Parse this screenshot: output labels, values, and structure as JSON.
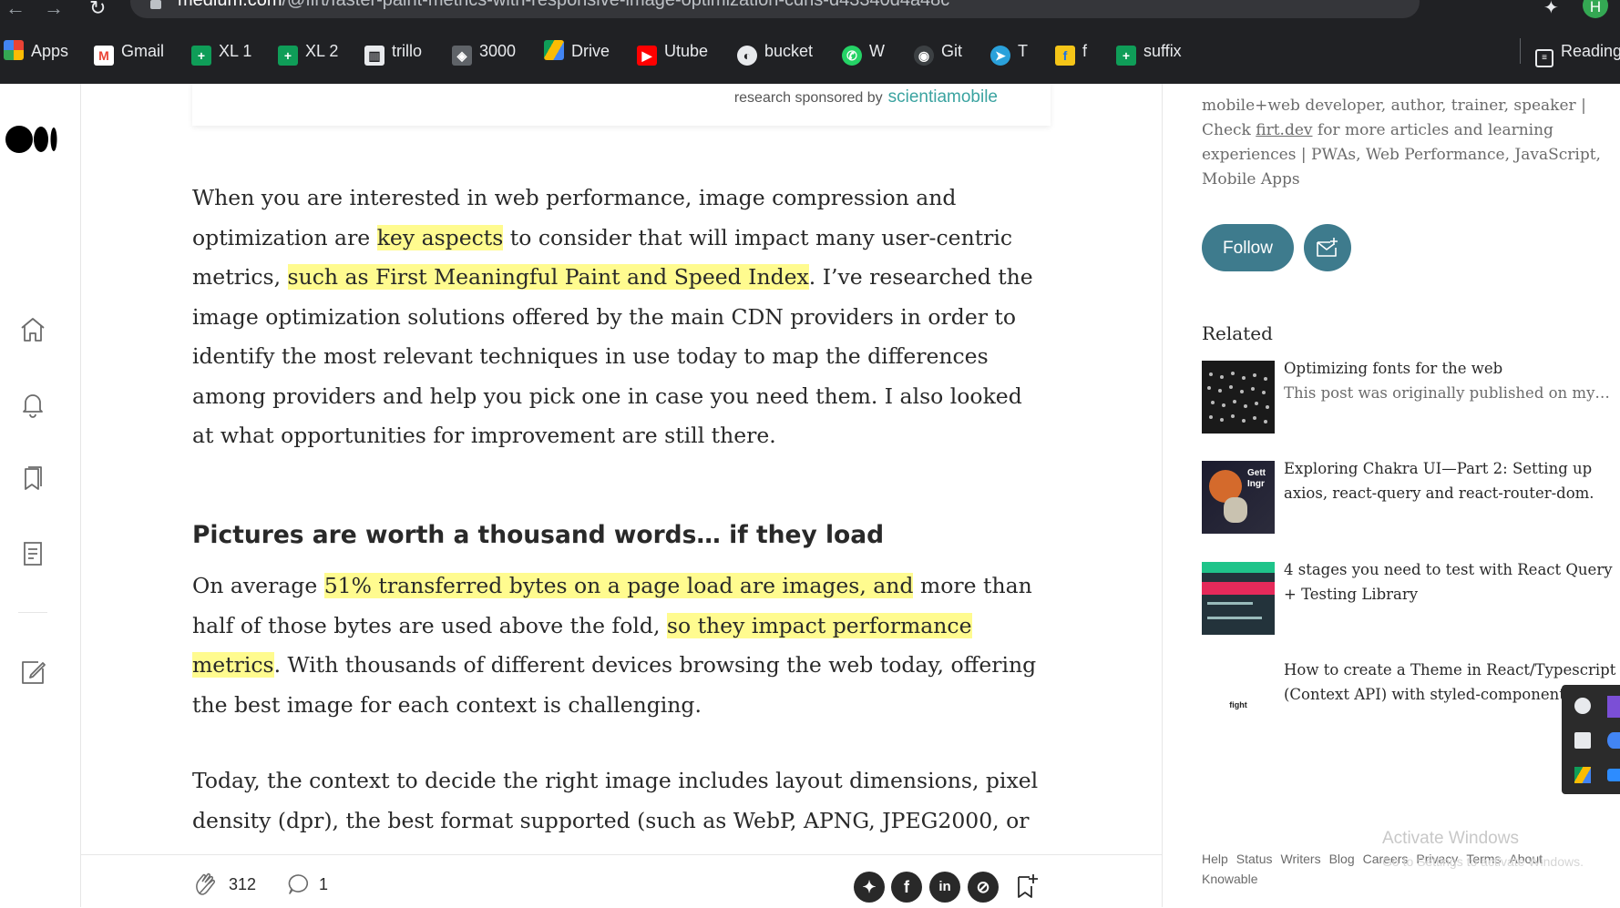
{
  "browser": {
    "url_host": "medium.com",
    "url_path": "/@firt/faster-paint-metrics-with-responsive-image-optimization-cdns-d43340d4a48c",
    "avatar_letter": "H",
    "bookmarks": [
      {
        "label": "Apps",
        "icon": "apps-grid-icon",
        "color": "#ea4335"
      },
      {
        "label": "Gmail",
        "icon": "gmail-icon",
        "color": "#ea4335"
      },
      {
        "label": "XL 1",
        "icon": "sheets-plus-icon",
        "color": "#0f9d58"
      },
      {
        "label": "XL 2",
        "icon": "sheets-plus-icon",
        "color": "#0f9d58"
      },
      {
        "label": "trillo",
        "icon": "trello-icon",
        "color": "#ffffff"
      },
      {
        "label": "3000",
        "icon": "site-icon",
        "color": "#5f6368"
      },
      {
        "label": "Drive",
        "icon": "drive-icon",
        "color": "#fbbc04"
      },
      {
        "label": "Utube",
        "icon": "youtube-icon",
        "color": "#ff0000"
      },
      {
        "label": "bucket",
        "icon": "globe-icon",
        "color": "#e8eaed"
      },
      {
        "label": "W",
        "icon": "whatsapp-icon",
        "color": "#25d366"
      },
      {
        "label": "Git",
        "icon": "github-icon",
        "color": "#3c4043"
      },
      {
        "label": "T",
        "icon": "telegram-icon",
        "color": "#2aa1db"
      },
      {
        "label": "f",
        "icon": "flipkart-icon",
        "color": "#f5c518"
      },
      {
        "label": "suffix",
        "icon": "sheets-plus-icon",
        "color": "#0f9d58"
      }
    ],
    "reading_list": "Reading"
  },
  "sponsor": {
    "prefix": "research sponsored by",
    "brand": "scientiamobile"
  },
  "article": {
    "p1_a": "When you are interested in web performance, image compression and optimization are ",
    "p1_h1": "key aspects",
    "p1_b": " to consider that will impact many user-centric metrics, ",
    "p1_h2": "such as First Meaningful Paint and Speed Index",
    "p1_c": ". I’ve researched the image optimization solutions offered by the main CDN providers in order to identify the most relevant techniques in use today to map the differences among providers and help you pick one in case you need them. I also looked at what opportunities for improvement are still there.",
    "heading": "Pictures are worth a thousand words… if they load",
    "p2_a": "On average ",
    "p2_h1": "51% transferred bytes on a page load are images, and",
    "p2_b": " more than half of those bytes are used above the fold, ",
    "p2_h2": "so they impact performance metrics",
    "p2_c": ". With thousands of different devices browsing the web today, offering the best image for each context is challenging.",
    "p3": "Today, the context to decide the right image includes layout dimensions, pixel density (dpr), the best format supported (such as WebP, APNG, JPEG2000, or"
  },
  "actions": {
    "claps": "312",
    "responses": "1"
  },
  "sidebar": {
    "bio_a": "mobile+web developer, author, trainer, speaker | Check ",
    "bio_link": "firt.dev",
    "bio_b": " for more articles and learning experiences | PWAs, Web Performance, JavaScript, Mobile Apps",
    "follow": "Follow",
    "related_title": "Related",
    "related": [
      {
        "title": "Optimizing fonts for the web",
        "subtitle": "This post was originally published on my blo…"
      },
      {
        "title": "Exploring Chakra UI—Part 2: Setting up axios, react-query and react-router-dom.",
        "subtitle": ""
      },
      {
        "title": "4 stages you need to test with React Query + Testing Library",
        "subtitle": ""
      },
      {
        "title": "How to create a Theme in React/Typescript (Context API) with styled-components",
        "subtitle": ""
      }
    ],
    "thumb2_text": "Gett Ingr",
    "thumb4_text": "fight",
    "footer": [
      "Help",
      "Status",
      "Writers",
      "Blog",
      "Careers",
      "Privacy",
      "Terms",
      "About",
      "Knowable"
    ]
  },
  "watermark": {
    "title": "Activate Windows",
    "subtitle": "Go to Settings to activate Windows."
  }
}
